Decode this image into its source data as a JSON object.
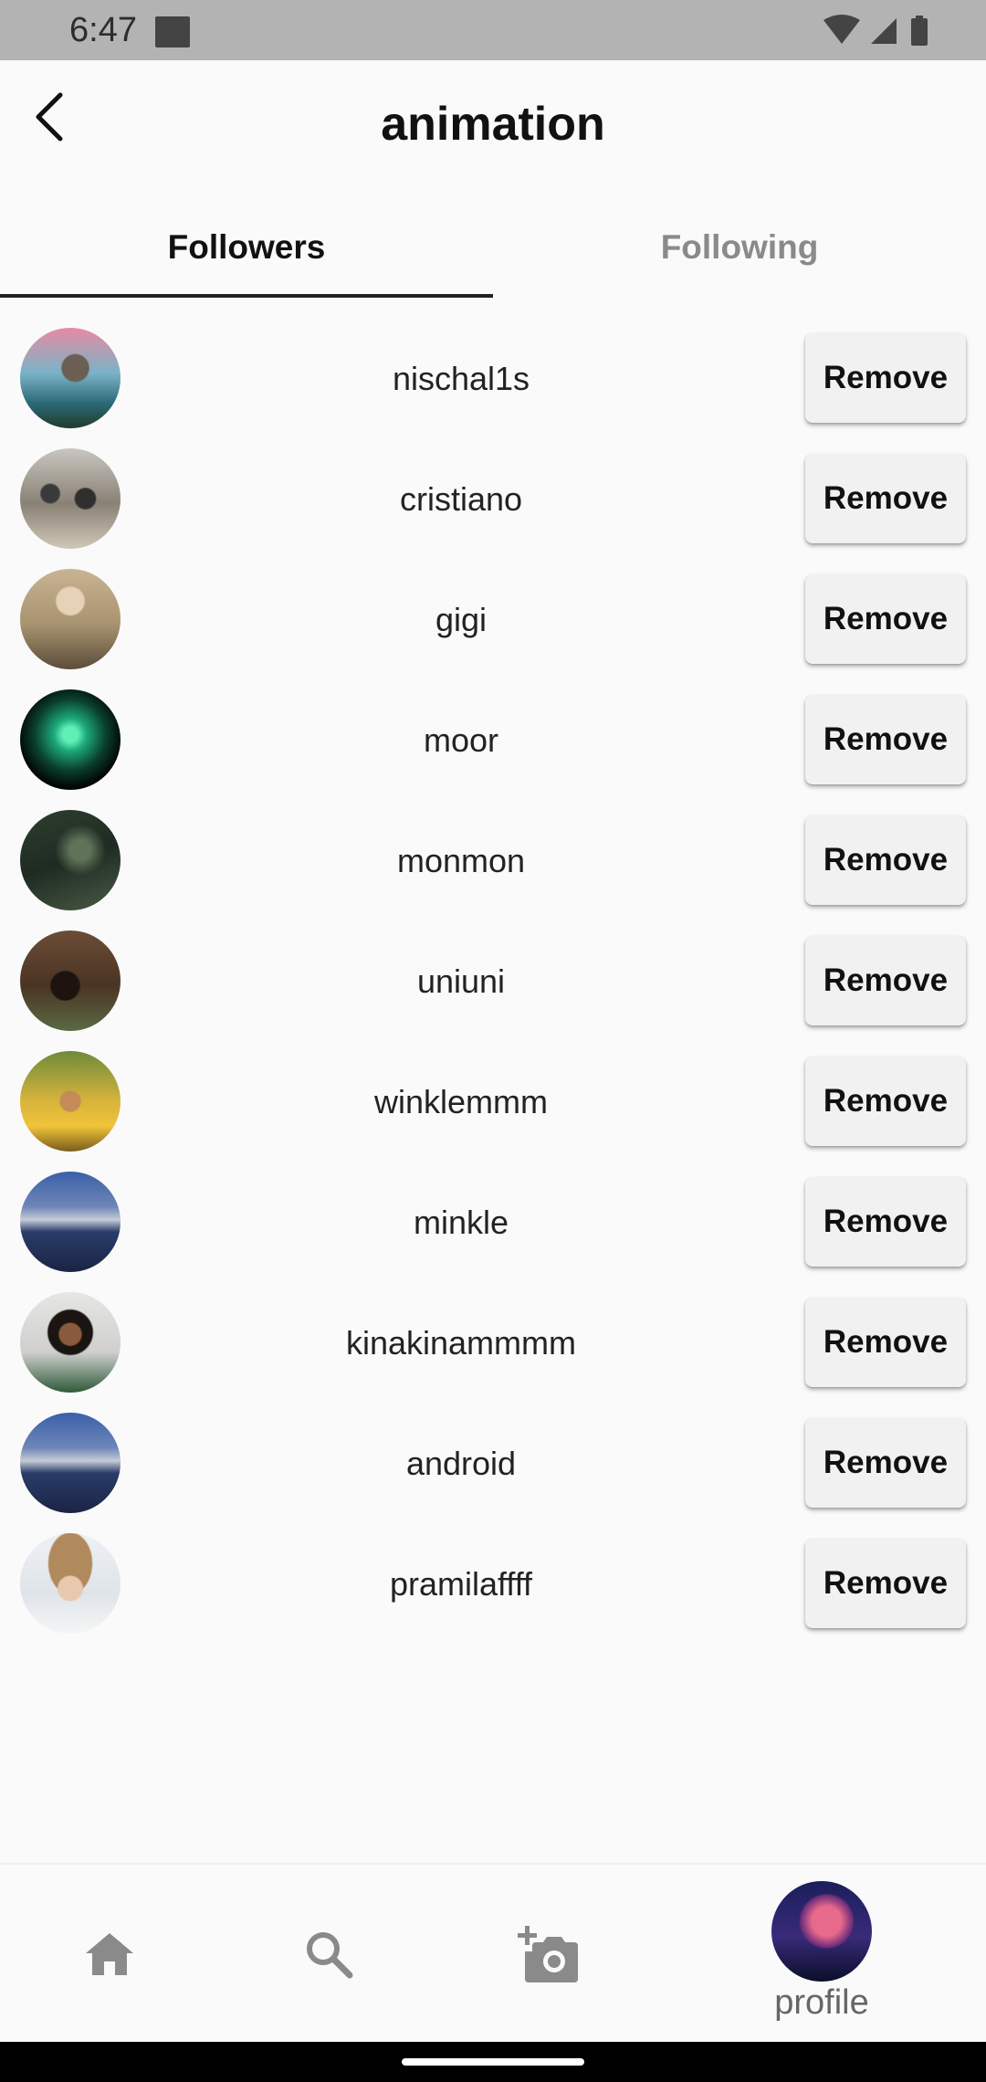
{
  "status_bar": {
    "time": "6:47"
  },
  "header": {
    "title": "animation"
  },
  "tabs": [
    {
      "label": "Followers",
      "active": true
    },
    {
      "label": "Following",
      "active": false
    }
  ],
  "followers": [
    {
      "username": "nischal1s",
      "button": "Remove"
    },
    {
      "username": "cristiano",
      "button": "Remove"
    },
    {
      "username": "gigi",
      "button": "Remove"
    },
    {
      "username": "moor",
      "button": "Remove"
    },
    {
      "username": "monmon",
      "button": "Remove"
    },
    {
      "username": "uniuni",
      "button": "Remove"
    },
    {
      "username": "winklemmm",
      "button": "Remove"
    },
    {
      "username": "minkle",
      "button": "Remove"
    },
    {
      "username": "kinakinammmm",
      "button": "Remove"
    },
    {
      "username": "android",
      "button": "Remove"
    },
    {
      "username": "pramilaffff",
      "button": "Remove"
    }
  ],
  "bottom_nav": {
    "home_icon": "home-icon",
    "search_icon": "search-icon",
    "add_icon": "add-photo-icon",
    "profile_label": "profile"
  },
  "colors": {
    "background": "#fafafa",
    "status_bar": "#b3b3b3",
    "button_bg": "#f1f1f1",
    "inactive_tab": "#8a8a8a"
  }
}
